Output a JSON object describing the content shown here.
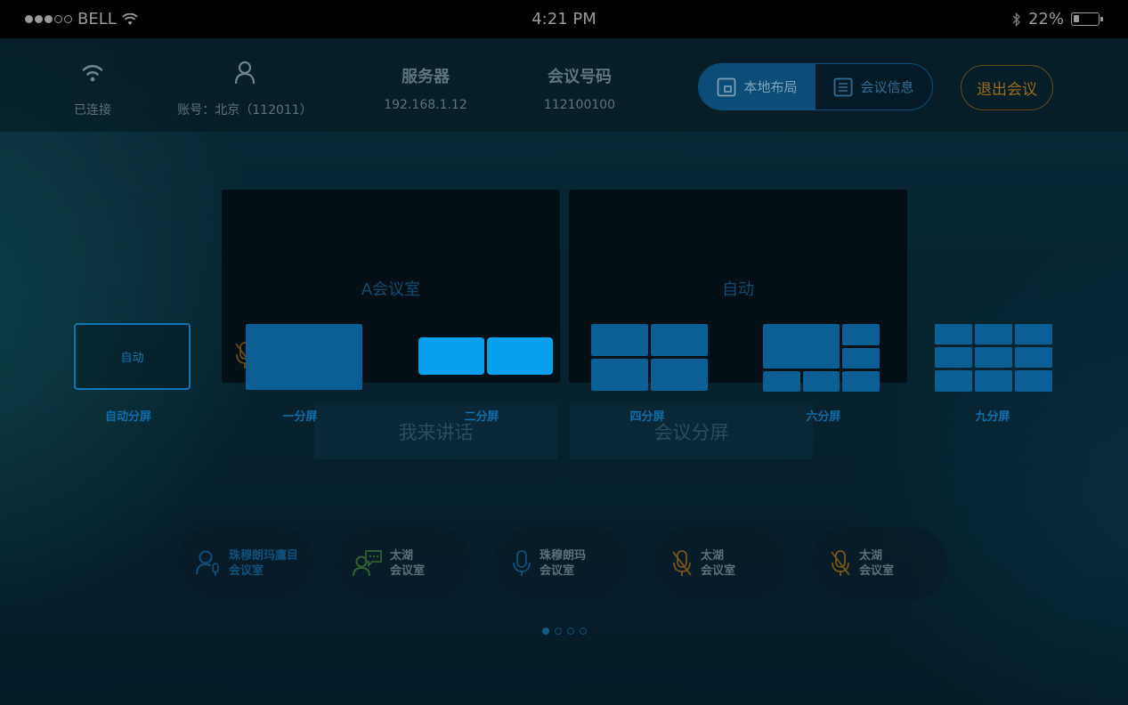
{
  "status_bar": {
    "carrier": "BELL",
    "time": "4:21 PM",
    "battery_text": "22%",
    "battery_level": 0.22
  },
  "info_bar": {
    "wifi": {
      "icon": "wifi-icon",
      "value": "已连接"
    },
    "account": {
      "icon": "user-icon",
      "value": "账号：北京（112011）"
    },
    "server": {
      "label": "服务器",
      "value": "192.168.1.12"
    },
    "meeting_number": {
      "label": "会议号码",
      "value": "112100100"
    }
  },
  "segment": {
    "local_layout": {
      "label": "本地布局",
      "icon": "layout-icon",
      "active": true
    },
    "meeting_info": {
      "label": "会议信息",
      "icon": "list-icon",
      "active": false
    }
  },
  "exit_button": {
    "label": "退出会议"
  },
  "panes": [
    {
      "label": "A会议室"
    },
    {
      "label": "自动"
    }
  ],
  "actions": {
    "speak": "我来讲话",
    "split": "会议分屏"
  },
  "layout_options": [
    {
      "box_label": "自动",
      "caption": "自动分屏"
    },
    {
      "caption": "一分屏"
    },
    {
      "caption": "二分屏"
    },
    {
      "caption": "四分屏"
    },
    {
      "caption": "六分屏"
    },
    {
      "caption": "九分屏"
    }
  ],
  "participants": [
    {
      "line1": "珠穆朗玛鷹目",
      "line2": "会议室",
      "icon": "user-mic-icon",
      "color": "#0f4f7a"
    },
    {
      "line1": "太湖",
      "line2": "会议室",
      "icon": "user-chat-icon",
      "color": "#2f6030"
    },
    {
      "line1": "珠穆朗玛",
      "line2": "会议室",
      "icon": "mic-icon",
      "color": "#0f4f7a"
    },
    {
      "line1": "太湖",
      "line2": "会议室",
      "icon": "mic-muted-icon",
      "color": "#7a5318"
    },
    {
      "line1": "太湖",
      "line2": "会议室",
      "icon": "mic-muted-icon",
      "color": "#7a5318"
    }
  ],
  "pager": {
    "pages": 4,
    "current": 1
  },
  "colors": {
    "accent_blue": "#0e79bb",
    "bright_blue": "#07a0ee",
    "exit_orange": "#9b6a1c"
  }
}
